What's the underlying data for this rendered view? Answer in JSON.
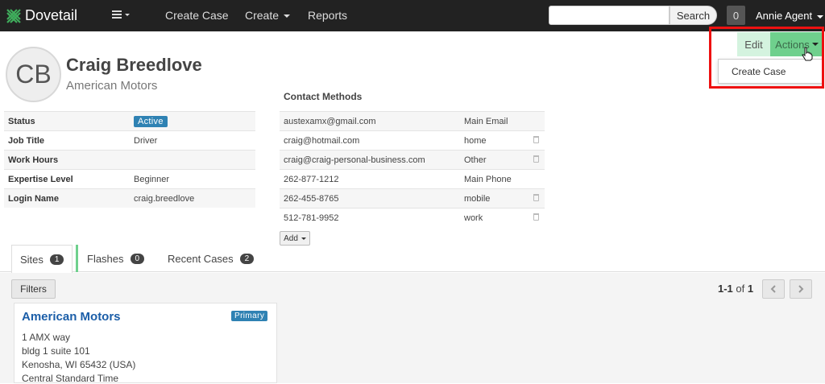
{
  "nav": {
    "brand": "Dovetail",
    "links": [
      "Create Case",
      "Create",
      "Reports"
    ],
    "search_button": "Search",
    "notifications": "0",
    "user": "Annie Agent"
  },
  "profile": {
    "initials": "CB",
    "name": "Craig Breedlove",
    "company": "American Motors"
  },
  "info": [
    {
      "label": "Status",
      "value": "Active"
    },
    {
      "label": "Job Title",
      "value": "Driver"
    },
    {
      "label": "Work Hours",
      "value": ""
    },
    {
      "label": "Expertise Level",
      "value": "Beginner"
    },
    {
      "label": "Login Name",
      "value": "craig.breedlove"
    }
  ],
  "contact_methods": {
    "title": "Contact Methods",
    "rows": [
      {
        "value": "austexamx@gmail.com",
        "type": "Main Email"
      },
      {
        "value": "craig@hotmail.com",
        "type": "home"
      },
      {
        "value": "craig@craig-personal-business.com",
        "type": "Other"
      },
      {
        "value": "262-877-1212",
        "type": "Main Phone"
      },
      {
        "value": "262-455-8765",
        "type": "mobile"
      },
      {
        "value": "512-781-9952",
        "type": "work"
      }
    ],
    "add_label": "Add"
  },
  "actions": {
    "edit": "Edit",
    "actions": "Actions",
    "menu_items": [
      "Create Case"
    ]
  },
  "tabs": [
    {
      "label": "Sites",
      "count": "1"
    },
    {
      "label": "Flashes",
      "count": "0"
    },
    {
      "label": "Recent Cases",
      "count": "2"
    }
  ],
  "sites": {
    "filters": "Filters",
    "pager_range": "1-1",
    "pager_of": "of",
    "pager_total": "1",
    "card": {
      "name": "American Motors",
      "badge": "Primary",
      "lines": [
        "1 AMX way",
        "bldg 1 suite 101",
        "Kenosha, WI 65432 (USA)",
        "Central Standard Time"
      ]
    }
  },
  "colors": {
    "nav_bg": "#222222",
    "accent_green": "#6fd08d",
    "badge_blue": "#2f82b3",
    "link_blue": "#1b5ea8",
    "highlight_red": "#ee1111"
  }
}
